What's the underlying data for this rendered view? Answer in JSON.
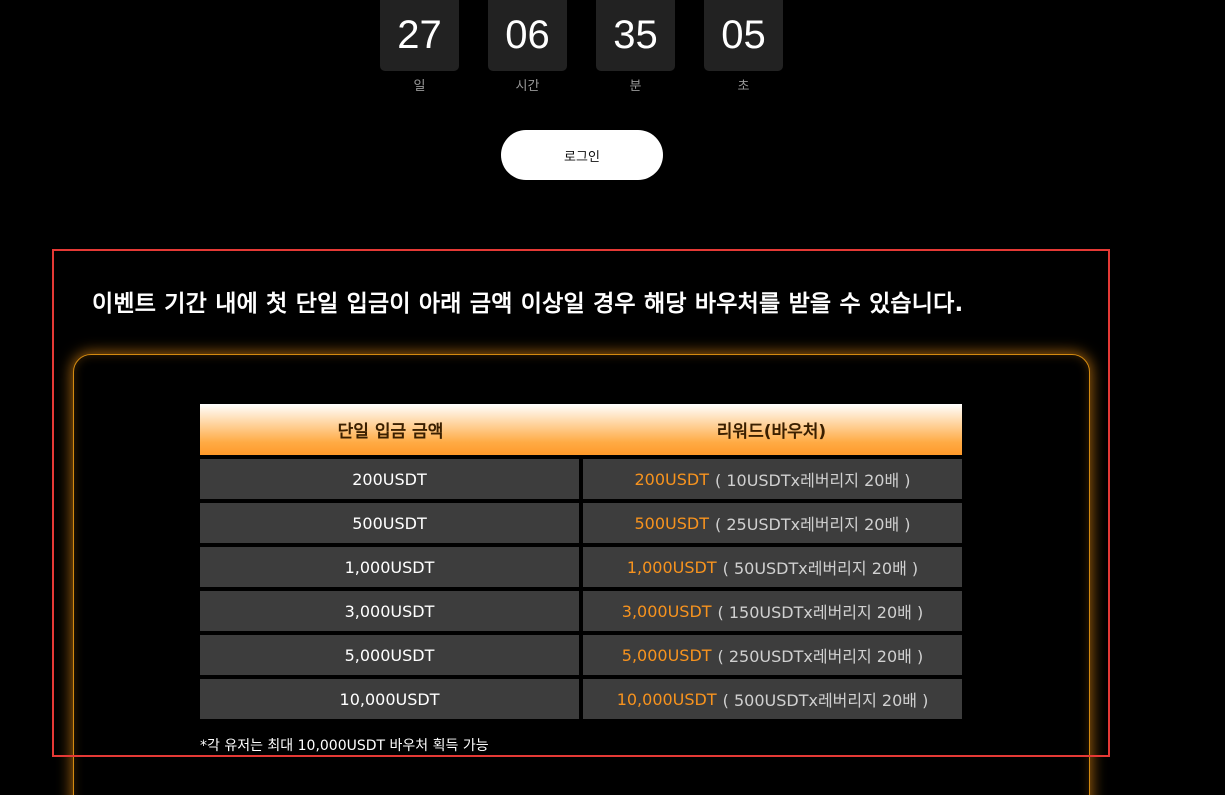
{
  "countdown": {
    "days": {
      "value": "27",
      "label": "일"
    },
    "hours": {
      "value": "06",
      "label": "시간"
    },
    "minutes": {
      "value": "35",
      "label": "분"
    },
    "seconds": {
      "value": "05",
      "label": "초"
    }
  },
  "login": {
    "label": "로그인"
  },
  "event": {
    "headline": "이벤트 기간 내에 첫 단일 입금이 아래 금액 이상일 경우 해당 바우처를 받을 수 있습니다.",
    "table": {
      "headers": [
        "단일 입금 금액",
        "리워드(바우처)"
      ],
      "rows": [
        {
          "amount": "200USDT",
          "reward": "200USDT",
          "detail": "( 10USDTx레버리지 20배 )"
        },
        {
          "amount": "500USDT",
          "reward": "500USDT",
          "detail": "( 25USDTx레버리지 20배 )"
        },
        {
          "amount": "1,000USDT",
          "reward": "1,000USDT",
          "detail": "( 50USDTx레버리지 20배 )"
        },
        {
          "amount": "3,000USDT",
          "reward": "3,000USDT",
          "detail": "( 150USDTx레버리지 20배 )"
        },
        {
          "amount": "5,000USDT",
          "reward": "5,000USDT",
          "detail": "( 250USDTx레버리지 20배 )"
        },
        {
          "amount": "10,000USDT",
          "reward": "10,000USDT",
          "detail": "( 500USDTx레버리지 20배 )"
        }
      ]
    },
    "footnote": "*각 유저는 최대 10,000USDT 바우처 획득 가능"
  },
  "colors": {
    "accent": "#f7931e",
    "highlight": "#e53935",
    "cell": "#3d3d3d",
    "countdown_box": "#222222"
  }
}
